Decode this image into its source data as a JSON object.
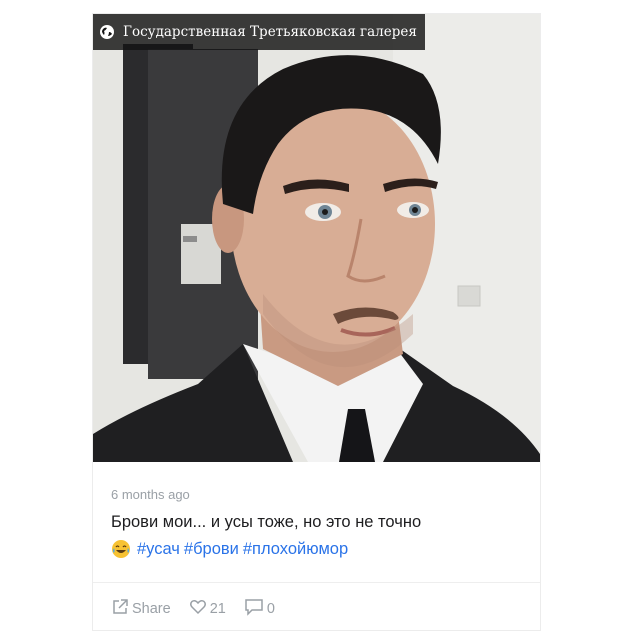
{
  "post": {
    "location": "Государственная Третьяковская галерея",
    "time_ago": "6 months ago",
    "caption": "Брови мои... и усы тоже, но это не точно",
    "emoji": "face-with-tears-of-joy",
    "hashtags": [
      "#усач",
      "#брови",
      "#плохойюмор"
    ]
  },
  "actions": {
    "share_label": "Share",
    "likes": "21",
    "comments": "0"
  },
  "colors": {
    "hashtag": "#2a73e8",
    "muted": "#9aa0a6",
    "location_bg": "#141414"
  },
  "icons": [
    "globe-icon",
    "share-icon",
    "heart-icon",
    "comment-icon"
  ]
}
